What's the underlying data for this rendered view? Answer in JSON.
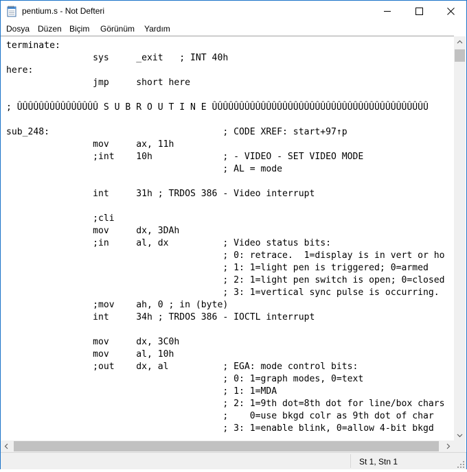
{
  "window": {
    "title": "pentium.s - Not Defteri",
    "icon": "notepad-icon",
    "controls": [
      "minimize-icon",
      "maximize-icon",
      "close-icon"
    ]
  },
  "menu": {
    "items": [
      {
        "label": "Dosya"
      },
      {
        "label": "Düzen"
      },
      {
        "label": "Biçim"
      },
      {
        "label": "Görünüm"
      },
      {
        "label": "Yardım"
      }
    ]
  },
  "editor": {
    "lines": [
      "terminate:",
      "                sys     _exit   ; INT 40h",
      "here:",
      "                jmp     short here",
      "",
      "; ÛÛÛÛÛÛÛÛÛÛÛÛÛÛÛ S U B R O U T I N E ÛÛÛÛÛÛÛÛÛÛÛÛÛÛÛÛÛÛÛÛÛÛÛÛÛÛÛÛÛÛÛÛÛÛÛÛÛÛÛÛ",
      "",
      "sub_248:                                ; CODE XREF: start+97↑p",
      "                mov     ax, 11h",
      "                ;int    10h             ; - VIDEO - SET VIDEO MODE",
      "                                        ; AL = mode",
      "",
      "                int     31h ; TRDOS 386 - Video interrupt",
      "",
      "                ;cli",
      "                mov     dx, 3DAh",
      "                ;in     al, dx          ; Video status bits:",
      "                                        ; 0: retrace.  1=display is in vert or ho",
      "                                        ; 1: 1=light pen is triggered; 0=armed",
      "                                        ; 2: 1=light pen switch is open; 0=closed",
      "                                        ; 3: 1=vertical sync pulse is occurring.",
      "                ;mov    ah, 0 ; in (byte)",
      "                int     34h ; TRDOS 386 - IOCTL interrupt",
      "",
      "                mov     dx, 3C0h",
      "                mov     al, 10h",
      "                ;out    dx, al          ; EGA: mode control bits:",
      "                                        ; 0: 1=graph modes, 0=text",
      "                                        ; 1: 1=MDA",
      "                                        ; 2: 1=9th dot=8th dot for line/box chars",
      "                                        ;    0=use bkgd colr as 9th dot of char",
      "                                        ; 3: 1=enable blink, 0=allow 4-bit bkgd"
    ]
  },
  "status": {
    "position": "St 1, Stn 1"
  }
}
